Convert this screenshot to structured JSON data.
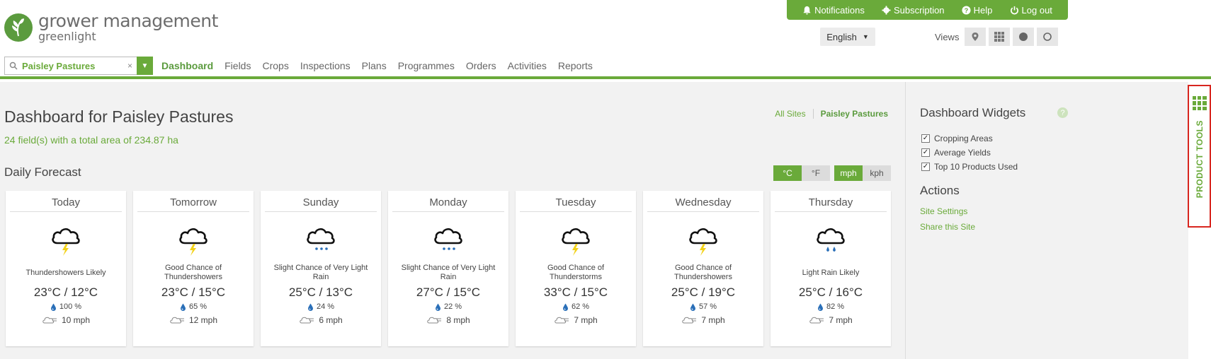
{
  "app": {
    "title": "grower management",
    "subtitle": "greenlight"
  },
  "topbar": {
    "notifications": "Notifications",
    "subscription": "Subscription",
    "help": "Help",
    "logout": "Log out"
  },
  "language": {
    "value": "English"
  },
  "views": {
    "label": "Views"
  },
  "search": {
    "value": "Paisley Pastures",
    "clear": "×"
  },
  "nav": [
    "Dashboard",
    "Fields",
    "Crops",
    "Inspections",
    "Plans",
    "Programmes",
    "Orders",
    "Activities",
    "Reports"
  ],
  "dashboard": {
    "title": "Dashboard for Paisley Pastures",
    "subtitle": "24 field(s) with a total area of 234.87 ha",
    "all_sites": "All Sites",
    "current_site": "Paisley Pastures"
  },
  "forecast": {
    "title": "Daily Forecast",
    "units_temp": [
      "°C",
      "°F"
    ],
    "units_wind": [
      "mph",
      "kph"
    ],
    "days": [
      {
        "day": "Today",
        "icon": "thunderstorm-icon",
        "desc": "Thundershowers Likely",
        "temp": "23°C / 12°C",
        "rain": "100 %",
        "wind": "10 mph"
      },
      {
        "day": "Tomorrow",
        "icon": "thunderstorm-icon",
        "desc": "Good Chance of Thundershowers",
        "temp": "23°C / 15°C",
        "rain": "65 %",
        "wind": "12 mph"
      },
      {
        "day": "Sunday",
        "icon": "light-rain-icon",
        "desc": "Slight Chance of Very Light Rain",
        "temp": "25°C / 13°C",
        "rain": "24 %",
        "wind": "6 mph"
      },
      {
        "day": "Monday",
        "icon": "light-rain-icon",
        "desc": "Slight Chance of Very Light Rain",
        "temp": "27°C / 15°C",
        "rain": "22 %",
        "wind": "8 mph"
      },
      {
        "day": "Tuesday",
        "icon": "thunderstorm-icon",
        "desc": "Good Chance of Thunderstorms",
        "temp": "33°C / 15°C",
        "rain": "62 %",
        "wind": "7 mph"
      },
      {
        "day": "Wednesday",
        "icon": "thunderstorm-icon",
        "desc": "Good Chance of Thundershowers",
        "temp": "25°C / 19°C",
        "rain": "57 %",
        "wind": "7 mph"
      },
      {
        "day": "Thursday",
        "icon": "rain-icon",
        "desc": "Light Rain Likely",
        "temp": "25°C / 16°C",
        "rain": "82 %",
        "wind": "7 mph"
      }
    ]
  },
  "widgets": {
    "title": "Dashboard Widgets",
    "help": "?",
    "items": [
      "Cropping Areas",
      "Average Yields",
      "Top 10 Products Used"
    ]
  },
  "actions": {
    "title": "Actions",
    "site_settings": "Site Settings",
    "share": "Share this Site"
  },
  "product_tools": {
    "label": "PRODUCT TOOLS"
  },
  "colors": {
    "brand": "#6aaa3a",
    "highlight": "#d8261f"
  }
}
